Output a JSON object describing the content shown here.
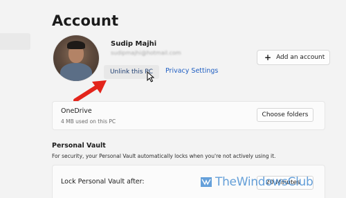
{
  "page": {
    "title": "Account"
  },
  "profile": {
    "name": "Sudip Majhi",
    "email": "sudipmajhi@hotmail.com",
    "unlink_label": "Unlink this PC",
    "privacy_label": "Privacy Settings"
  },
  "actions": {
    "add_account_label": "Add an account"
  },
  "onedrive": {
    "title": "OneDrive",
    "usage": "4 MB used on this PC",
    "button_label": "Choose folders"
  },
  "personal_vault": {
    "heading": "Personal Vault",
    "description": "For security, your Personal Vault automatically locks when you're not actively using it.",
    "lock_label": "Lock Personal Vault after:",
    "lock_value": "20 Minutes"
  },
  "watermark": {
    "text": "TheWindowsClub"
  },
  "colors": {
    "link": "#1f5ec2",
    "arrow": "#e3241b",
    "background": "#f3f3f3"
  }
}
